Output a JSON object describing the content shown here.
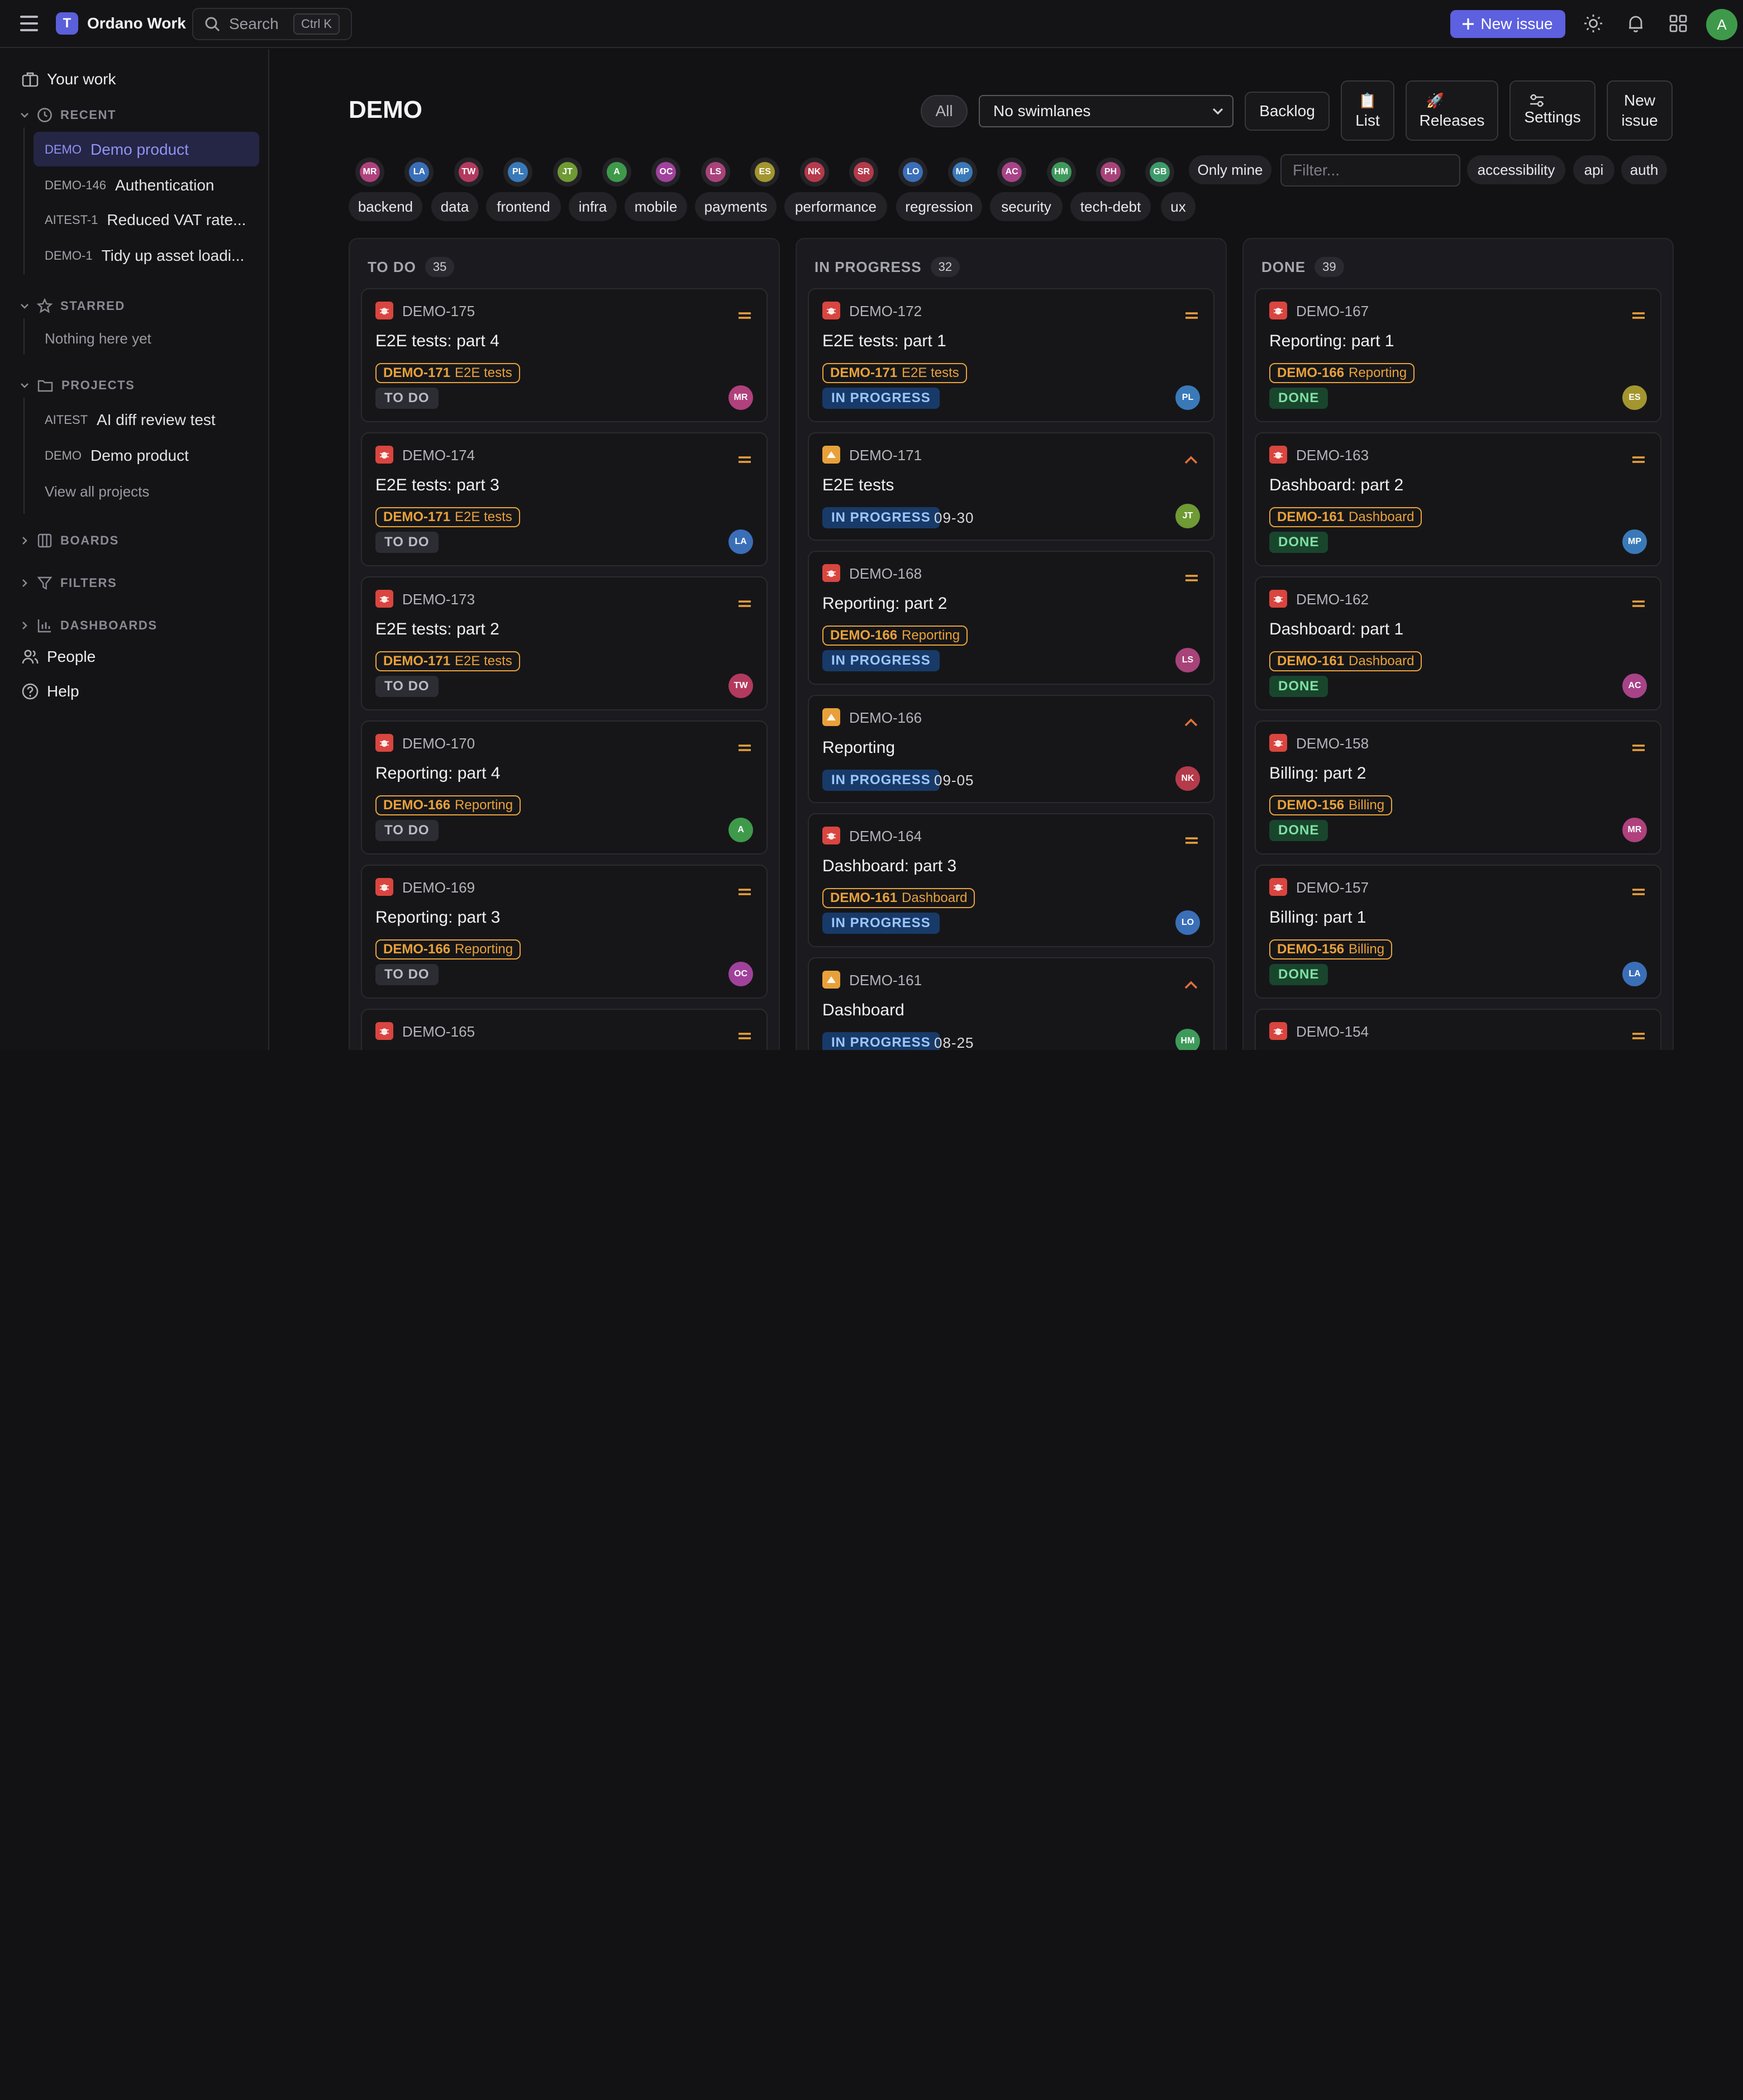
{
  "app": {
    "name": "Ordano Work",
    "logo_letter": "T",
    "search_placeholder": "Search",
    "search_shortcut": "Ctrl K",
    "new_issue_label": "New issue",
    "user_initial": "A"
  },
  "sidebar": {
    "your_work": "Your work",
    "recent_title": "RECENT",
    "recent_items": [
      {
        "key": "DEMO",
        "label": "Demo product"
      },
      {
        "key": "DEMO-146",
        "label": "Authentication"
      },
      {
        "key": "AITEST-1",
        "label": "Reduced VAT rate..."
      },
      {
        "key": "DEMO-1",
        "label": "Tidy up asset loadi..."
      }
    ],
    "starred_title": "STARRED",
    "starred_empty": "Nothing here yet",
    "projects_title": "PROJECTS",
    "project_items": [
      {
        "key": "AITEST",
        "label": "AI diff review test"
      },
      {
        "key": "DEMO",
        "label": "Demo product"
      }
    ],
    "view_all_projects": "View all projects",
    "boards_title": "BOARDS",
    "filters_title": "FILTERS",
    "dashboards_title": "DASHBOARDS",
    "people": "People",
    "help": "Help"
  },
  "board": {
    "title": "DEMO",
    "all_label": "All",
    "swimlanes_value": "No swimlanes",
    "backlog_label": "Backlog",
    "list_label": "List",
    "releases_label": "Releases",
    "settings_label": "Settings",
    "new_issue_line1": "New",
    "new_issue_line2": "issue",
    "list_emoji": "📋",
    "releases_emoji": "🚀",
    "only_mine_label": "Only mine",
    "filter_placeholder": "Filter...",
    "people_filters": [
      {
        "initials": "MR",
        "color": "#b0417d"
      },
      {
        "initials": "LA",
        "color": "#3a6fb8"
      },
      {
        "initials": "TW",
        "color": "#b23a5f"
      },
      {
        "initials": "PL",
        "color": "#3a79b8"
      },
      {
        "initials": "JT",
        "color": "#6f9a34"
      },
      {
        "initials": "A",
        "color": "#3e9a4a"
      },
      {
        "initials": "OC",
        "color": "#a0429c"
      },
      {
        "initials": "LS",
        "color": "#a8437a"
      },
      {
        "initials": "ES",
        "color": "#a3962f"
      },
      {
        "initials": "NK",
        "color": "#b53a4b"
      },
      {
        "initials": "SR",
        "color": "#b53a4b"
      },
      {
        "initials": "LO",
        "color": "#3a6fb8"
      },
      {
        "initials": "MP",
        "color": "#3a79b8"
      },
      {
        "initials": "AC",
        "color": "#a84388"
      },
      {
        "initials": "HM",
        "color": "#3e9a5a"
      },
      {
        "initials": "PH",
        "color": "#a8437a"
      },
      {
        "initials": "GB",
        "color": "#3e9a6a"
      }
    ],
    "label_filters_row1": [
      "accessibility",
      "api",
      "auth"
    ],
    "label_filters_row2": [
      "backend",
      "data",
      "frontend",
      "infra",
      "mobile",
      "payments",
      "performance",
      "regression",
      "security",
      "tech-debt",
      "ux"
    ]
  },
  "columns": [
    {
      "title": "TO DO",
      "count": "35",
      "cards": [
        {
          "type": "bug",
          "key": "DEMO-175",
          "prio": "medium",
          "title": "E2E tests: part 4",
          "epic_key": "DEMO-171",
          "epic_name": "E2E tests",
          "status": "TO DO",
          "due": "",
          "assignee": "MR",
          "assignee_color": "#b0417d"
        },
        {
          "type": "bug",
          "key": "DEMO-174",
          "prio": "medium",
          "title": "E2E tests: part 3",
          "epic_key": "DEMO-171",
          "epic_name": "E2E tests",
          "status": "TO DO",
          "due": "",
          "assignee": "LA",
          "assignee_color": "#3a6fb8"
        },
        {
          "type": "bug",
          "key": "DEMO-173",
          "prio": "medium",
          "title": "E2E tests: part 2",
          "epic_key": "DEMO-171",
          "epic_name": "E2E tests",
          "status": "TO DO",
          "due": "",
          "assignee": "TW",
          "assignee_color": "#b23a5f"
        },
        {
          "type": "bug",
          "key": "DEMO-170",
          "prio": "medium",
          "title": "Reporting: part 4",
          "epic_key": "DEMO-166",
          "epic_name": "Reporting",
          "status": "TO DO",
          "due": "",
          "assignee": "A",
          "assignee_color": "#3e9a4a"
        },
        {
          "type": "bug",
          "key": "DEMO-169",
          "prio": "medium",
          "title": "Reporting: part 3",
          "epic_key": "DEMO-166",
          "epic_name": "Reporting",
          "status": "TO DO",
          "due": "",
          "assignee": "OC",
          "assignee_color": "#a0429c"
        },
        {
          "type": "bug",
          "key": "DEMO-165",
          "prio": "medium",
          "title": "",
          "epic_key": "",
          "epic_name": "",
          "status": "",
          "due": "",
          "assignee": "",
          "assignee_color": ""
        }
      ]
    },
    {
      "title": "IN PROGRESS",
      "count": "32",
      "cards": [
        {
          "type": "bug",
          "key": "DEMO-172",
          "prio": "medium",
          "title": "E2E tests: part 1",
          "epic_key": "DEMO-171",
          "epic_name": "E2E tests",
          "status": "IN PROGRESS",
          "due": "",
          "assignee": "PL",
          "assignee_color": "#3a79b8"
        },
        {
          "type": "epic",
          "key": "DEMO-171",
          "prio": "high",
          "title": "E2E tests",
          "epic_key": "",
          "epic_name": "",
          "status": "IN PROGRESS",
          "due": "09-30",
          "assignee": "JT",
          "assignee_color": "#6f9a34"
        },
        {
          "type": "bug",
          "key": "DEMO-168",
          "prio": "medium",
          "title": "Reporting: part 2",
          "epic_key": "DEMO-166",
          "epic_name": "Reporting",
          "status": "IN PROGRESS",
          "due": "",
          "assignee": "LS",
          "assignee_color": "#a8437a"
        },
        {
          "type": "epic",
          "key": "DEMO-166",
          "prio": "high",
          "title": "Reporting",
          "epic_key": "",
          "epic_name": "",
          "status": "IN PROGRESS",
          "due": "09-05",
          "assignee": "NK",
          "assignee_color": "#b53a4b"
        },
        {
          "type": "bug",
          "key": "DEMO-164",
          "prio": "medium",
          "title": "Dashboard: part 3",
          "epic_key": "DEMO-161",
          "epic_name": "Dashboard",
          "status": "IN PROGRESS",
          "due": "",
          "assignee": "LO",
          "assignee_color": "#3a6fb8"
        },
        {
          "type": "epic",
          "key": "DEMO-161",
          "prio": "high",
          "title": "Dashboard",
          "epic_key": "",
          "epic_name": "",
          "status": "IN PROGRESS",
          "due": "08-25",
          "assignee": "HM",
          "assignee_color": "#3e9a5a"
        }
      ]
    },
    {
      "title": "DONE",
      "count": "39",
      "cards": [
        {
          "type": "bug",
          "key": "DEMO-167",
          "prio": "medium",
          "title": "Reporting: part 1",
          "epic_key": "DEMO-166",
          "epic_name": "Reporting",
          "status": "DONE",
          "due": "",
          "assignee": "ES",
          "assignee_color": "#a3962f"
        },
        {
          "type": "bug",
          "key": "DEMO-163",
          "prio": "medium",
          "title": "Dashboard: part 2",
          "epic_key": "DEMO-161",
          "epic_name": "Dashboard",
          "status": "DONE",
          "due": "",
          "assignee": "MP",
          "assignee_color": "#3a79b8"
        },
        {
          "type": "bug",
          "key": "DEMO-162",
          "prio": "medium",
          "title": "Dashboard: part 1",
          "epic_key": "DEMO-161",
          "epic_name": "Dashboard",
          "status": "DONE",
          "due": "",
          "assignee": "AC",
          "assignee_color": "#a84388"
        },
        {
          "type": "bug",
          "key": "DEMO-158",
          "prio": "medium",
          "title": "Billing: part 2",
          "epic_key": "DEMO-156",
          "epic_name": "Billing",
          "status": "DONE",
          "due": "",
          "assignee": "MR",
          "assignee_color": "#b0417d"
        },
        {
          "type": "bug",
          "key": "DEMO-157",
          "prio": "medium",
          "title": "Billing: part 1",
          "epic_key": "DEMO-156",
          "epic_name": "Billing",
          "status": "DONE",
          "due": "",
          "assignee": "LA",
          "assignee_color": "#3a6fb8"
        },
        {
          "type": "bug",
          "key": "DEMO-154",
          "prio": "medium",
          "title": "",
          "epic_key": "",
          "epic_name": "",
          "status": "",
          "due": "",
          "assignee": "",
          "assignee_color": ""
        }
      ]
    }
  ],
  "colors": {
    "accent": "#5d60df",
    "bug": "#d9453f",
    "epic": "#e8a13a",
    "priority_medium": "#e8a13a",
    "priority_high": "#e0703a"
  }
}
